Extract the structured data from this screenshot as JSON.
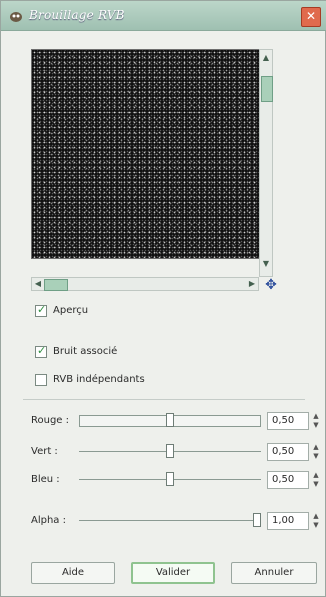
{
  "window": {
    "title": "Brouillage RVB",
    "close_symbol": "✕"
  },
  "preview": {
    "navigate_symbol": "✥"
  },
  "options": {
    "apercu": {
      "label": "Aperçu",
      "checked": true
    },
    "bruit_associe": {
      "label": "Bruit associé",
      "checked": true
    },
    "rvb_independants": {
      "label": "RVB indépendants",
      "checked": false
    }
  },
  "sliders": [
    {
      "label": "Rouge :",
      "value": "0,50",
      "fraction": 0.5
    },
    {
      "label": "Vert :",
      "value": "0,50",
      "fraction": 0.5
    },
    {
      "label": "Bleu :",
      "value": "0,50",
      "fraction": 0.5
    },
    {
      "label": "Alpha :",
      "value": "1,00",
      "fraction": 1.0
    }
  ],
  "buttons": {
    "help": "Aide",
    "ok": "Valider",
    "cancel": "Annuler"
  }
}
